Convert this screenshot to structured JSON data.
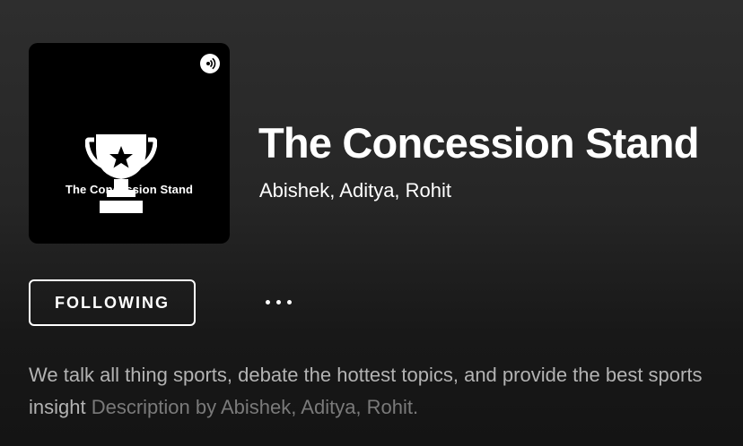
{
  "podcast": {
    "cover_text": "The Concession Stand",
    "title": "The Concession Stand",
    "authors": "Abishek, Aditya, Rohit"
  },
  "actions": {
    "follow_label": "FOLLOWING",
    "more_icon": "more-horizontal-icon"
  },
  "description": {
    "text": "We talk all thing sports, debate the hottest topics, and provide the best sports insight",
    "attribution": "Description by Abishek, Aditya, Rohit."
  },
  "colors": {
    "background_top": "#2e2e2e",
    "background_bottom": "#141414",
    "text_primary": "#ffffff",
    "text_secondary": "#b3b3b3",
    "text_muted": "#7a7a7a"
  }
}
